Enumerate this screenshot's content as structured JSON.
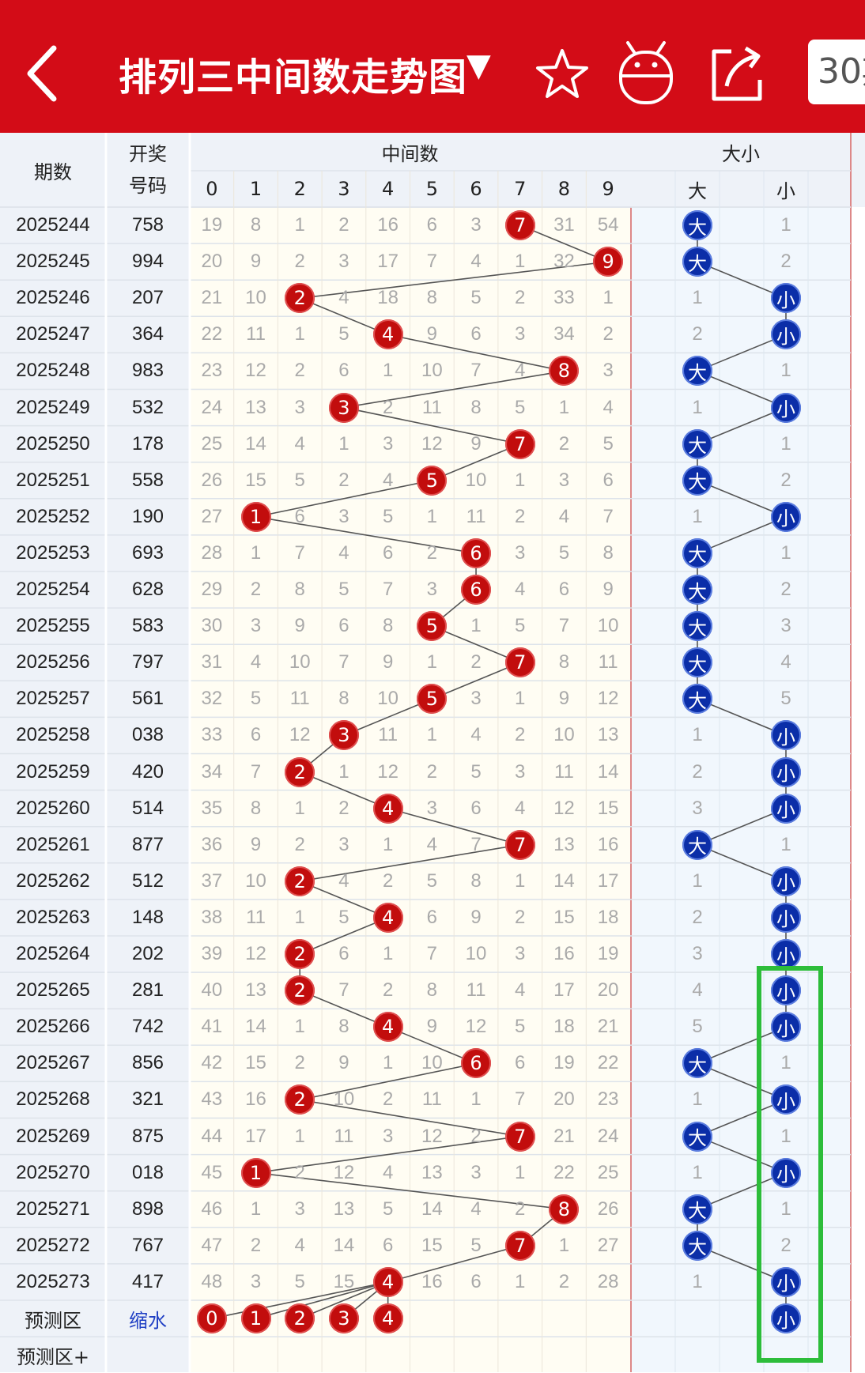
{
  "header": {
    "title": "排列三中间数走势图",
    "dropdown_icon": "triangle-down-icon",
    "back_icon": "chevron-left-icon",
    "star_icon": "star-icon",
    "robot_icon": "robot-icon",
    "share_icon": "share-icon",
    "count_button": "30"
  },
  "colors": {
    "header_bg": "#d30c17",
    "red_ball": "#c20d0d",
    "blue_ball": "#0b2ea8",
    "highlight_box": "#2dbd3a"
  },
  "columns": {
    "issue": "期数",
    "draw_line1": "开奖",
    "draw_line2": "号码",
    "middle_group": "中间数",
    "size_group": "大小",
    "digits": [
      "0",
      "1",
      "2",
      "3",
      "4",
      "5",
      "6",
      "7",
      "8",
      "9"
    ],
    "size_big": "大",
    "size_small": "小"
  },
  "rows": [
    {
      "issue": "2025244",
      "draw": "758",
      "mid": 7,
      "miss": [
        19,
        8,
        1,
        2,
        16,
        6,
        3,
        null,
        31,
        54
      ],
      "size": "大",
      "size_miss": [
        null,
        1
      ]
    },
    {
      "issue": "2025245",
      "draw": "994",
      "mid": 9,
      "miss": [
        20,
        9,
        2,
        3,
        17,
        7,
        4,
        1,
        32,
        null
      ],
      "size": "大",
      "size_miss": [
        null,
        2
      ]
    },
    {
      "issue": "2025246",
      "draw": "207",
      "mid": 2,
      "miss": [
        21,
        10,
        null,
        4,
        18,
        8,
        5,
        2,
        33,
        1
      ],
      "size": "小",
      "size_miss": [
        1,
        null
      ]
    },
    {
      "issue": "2025247",
      "draw": "364",
      "mid": 4,
      "miss": [
        22,
        11,
        1,
        5,
        null,
        9,
        6,
        3,
        34,
        2
      ],
      "size": "小",
      "size_miss": [
        2,
        null
      ]
    },
    {
      "issue": "2025248",
      "draw": "983",
      "mid": 8,
      "miss": [
        23,
        12,
        2,
        6,
        1,
        10,
        7,
        4,
        null,
        3
      ],
      "size": "大",
      "size_miss": [
        null,
        1
      ]
    },
    {
      "issue": "2025249",
      "draw": "532",
      "mid": 3,
      "miss": [
        24,
        13,
        3,
        null,
        2,
        11,
        8,
        5,
        1,
        4
      ],
      "size": "小",
      "size_miss": [
        1,
        null
      ]
    },
    {
      "issue": "2025250",
      "draw": "178",
      "mid": 7,
      "miss": [
        25,
        14,
        4,
        1,
        3,
        12,
        9,
        null,
        2,
        5
      ],
      "size": "大",
      "size_miss": [
        null,
        1
      ]
    },
    {
      "issue": "2025251",
      "draw": "558",
      "mid": 5,
      "miss": [
        26,
        15,
        5,
        2,
        4,
        null,
        10,
        1,
        3,
        6
      ],
      "size": "大",
      "size_miss": [
        null,
        2
      ]
    },
    {
      "issue": "2025252",
      "draw": "190",
      "mid": 1,
      "miss": [
        27,
        null,
        6,
        3,
        5,
        1,
        11,
        2,
        4,
        7
      ],
      "size": "小",
      "size_miss": [
        1,
        null
      ]
    },
    {
      "issue": "2025253",
      "draw": "693",
      "mid": 6,
      "miss": [
        28,
        1,
        7,
        4,
        6,
        2,
        null,
        3,
        5,
        8
      ],
      "size": "大",
      "size_miss": [
        null,
        1
      ]
    },
    {
      "issue": "2025254",
      "draw": "628",
      "mid": 6,
      "miss": [
        29,
        2,
        8,
        5,
        7,
        3,
        null,
        4,
        6,
        9
      ],
      "size": "大",
      "size_miss": [
        null,
        2
      ]
    },
    {
      "issue": "2025255",
      "draw": "583",
      "mid": 5,
      "miss": [
        30,
        3,
        9,
        6,
        8,
        null,
        1,
        5,
        7,
        10
      ],
      "size": "大",
      "size_miss": [
        null,
        3
      ]
    },
    {
      "issue": "2025256",
      "draw": "797",
      "mid": 7,
      "miss": [
        31,
        4,
        10,
        7,
        9,
        1,
        2,
        null,
        8,
        11
      ],
      "size": "大",
      "size_miss": [
        null,
        4
      ]
    },
    {
      "issue": "2025257",
      "draw": "561",
      "mid": 5,
      "miss": [
        32,
        5,
        11,
        8,
        10,
        null,
        3,
        1,
        9,
        12
      ],
      "size": "大",
      "size_miss": [
        null,
        5
      ]
    },
    {
      "issue": "2025258",
      "draw": "038",
      "mid": 3,
      "miss": [
        33,
        6,
        12,
        null,
        11,
        1,
        4,
        2,
        10,
        13
      ],
      "size": "小",
      "size_miss": [
        1,
        null
      ]
    },
    {
      "issue": "2025259",
      "draw": "420",
      "mid": 2,
      "miss": [
        34,
        7,
        null,
        1,
        12,
        2,
        5,
        3,
        11,
        14
      ],
      "size": "小",
      "size_miss": [
        2,
        null
      ]
    },
    {
      "issue": "2025260",
      "draw": "514",
      "mid": 4,
      "miss": [
        35,
        8,
        1,
        2,
        null,
        3,
        6,
        4,
        12,
        15
      ],
      "size": "小",
      "size_miss": [
        3,
        null
      ]
    },
    {
      "issue": "2025261",
      "draw": "877",
      "mid": 7,
      "miss": [
        36,
        9,
        2,
        3,
        1,
        4,
        7,
        null,
        13,
        16
      ],
      "size": "大",
      "size_miss": [
        null,
        1
      ]
    },
    {
      "issue": "2025262",
      "draw": "512",
      "mid": 2,
      "miss": [
        37,
        10,
        null,
        4,
        2,
        5,
        8,
        1,
        14,
        17
      ],
      "size": "小",
      "size_miss": [
        1,
        null
      ]
    },
    {
      "issue": "2025263",
      "draw": "148",
      "mid": 4,
      "miss": [
        38,
        11,
        1,
        5,
        null,
        6,
        9,
        2,
        15,
        18
      ],
      "size": "小",
      "size_miss": [
        2,
        null
      ]
    },
    {
      "issue": "2025264",
      "draw": "202",
      "mid": 2,
      "miss": [
        39,
        12,
        null,
        6,
        1,
        7,
        10,
        3,
        16,
        19
      ],
      "size": "小",
      "size_miss": [
        3,
        null
      ]
    },
    {
      "issue": "2025265",
      "draw": "281",
      "mid": 2,
      "miss": [
        40,
        13,
        null,
        7,
        2,
        8,
        11,
        4,
        17,
        20
      ],
      "size": "小",
      "size_miss": [
        4,
        null
      ]
    },
    {
      "issue": "2025266",
      "draw": "742",
      "mid": 4,
      "miss": [
        41,
        14,
        1,
        8,
        null,
        9,
        12,
        5,
        18,
        21
      ],
      "size": "小",
      "size_miss": [
        5,
        null
      ]
    },
    {
      "issue": "2025267",
      "draw": "856",
      "mid": 6,
      "miss": [
        42,
        15,
        2,
        9,
        1,
        10,
        null,
        6,
        19,
        22
      ],
      "size": "大",
      "size_miss": [
        null,
        1
      ]
    },
    {
      "issue": "2025268",
      "draw": "321",
      "mid": 2,
      "miss": [
        43,
        16,
        null,
        10,
        2,
        11,
        1,
        7,
        20,
        23
      ],
      "size": "小",
      "size_miss": [
        1,
        null
      ]
    },
    {
      "issue": "2025269",
      "draw": "875",
      "mid": 7,
      "miss": [
        44,
        17,
        1,
        11,
        3,
        12,
        2,
        null,
        21,
        24
      ],
      "size": "大",
      "size_miss": [
        null,
        1
      ]
    },
    {
      "issue": "2025270",
      "draw": "018",
      "mid": 1,
      "miss": [
        45,
        null,
        2,
        12,
        4,
        13,
        3,
        1,
        22,
        25
      ],
      "size": "小",
      "size_miss": [
        1,
        null
      ]
    },
    {
      "issue": "2025271",
      "draw": "898",
      "mid": 8,
      "miss": [
        46,
        1,
        3,
        13,
        5,
        14,
        4,
        2,
        null,
        26
      ],
      "size": "大",
      "size_miss": [
        null,
        1
      ]
    },
    {
      "issue": "2025272",
      "draw": "767",
      "mid": 7,
      "miss": [
        47,
        2,
        4,
        14,
        6,
        15,
        5,
        null,
        1,
        27
      ],
      "size": "大",
      "size_miss": [
        null,
        2
      ]
    },
    {
      "issue": "2025273",
      "draw": "417",
      "mid": 4,
      "miss": [
        48,
        3,
        5,
        15,
        null,
        16,
        6,
        1,
        2,
        28
      ],
      "size": "小",
      "size_miss": [
        1,
        null
      ]
    }
  ],
  "forecast": {
    "label": "预测区",
    "link": "缩水",
    "digits": [
      0,
      1,
      2,
      3,
      4
    ],
    "size": "小"
  },
  "forecast_plus": {
    "label": "预测区+"
  }
}
